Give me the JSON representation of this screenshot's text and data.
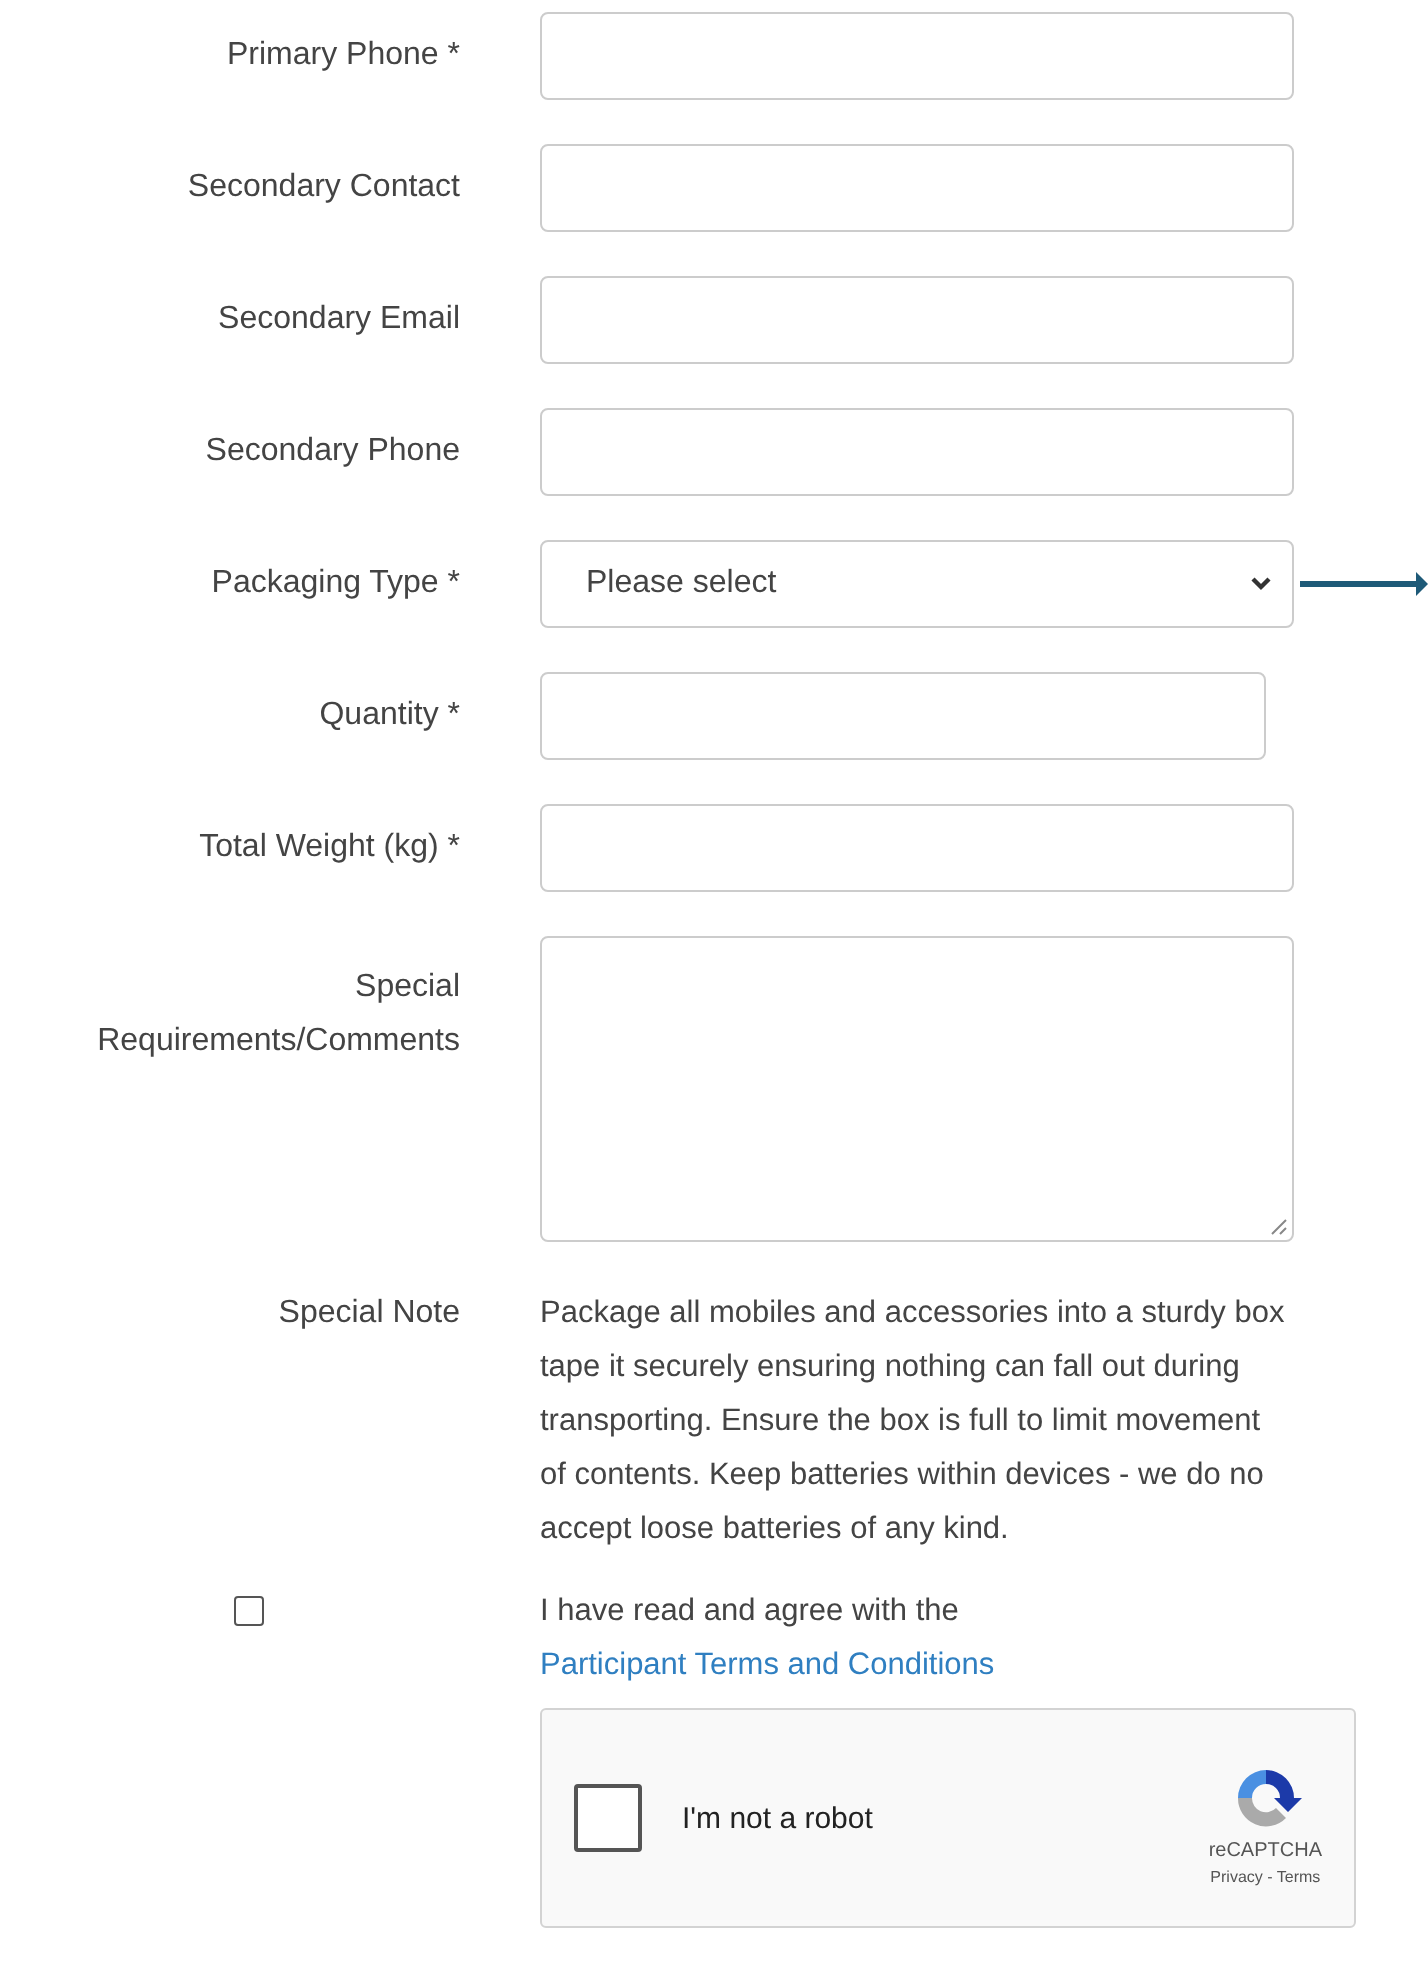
{
  "fields": [
    {
      "label": "Primary Phone *",
      "kind": "text"
    },
    {
      "label": "Secondary Contact",
      "kind": "text"
    },
    {
      "label": "Secondary Email",
      "kind": "text"
    },
    {
      "label": "Secondary Phone",
      "kind": "text"
    },
    {
      "label": "Packaging Type *",
      "kind": "select",
      "value": "Please select"
    },
    {
      "label": "Quantity *",
      "kind": "short"
    },
    {
      "label": "Total Weight (kg) *",
      "kind": "text"
    },
    {
      "label": "Special Requirements/Comments",
      "kind": "textarea"
    }
  ],
  "note": {
    "label": "Special Note",
    "lines": [
      "Package all mobiles and accessories into a sturdy box",
      "tape it securely ensuring nothing can fall out during",
      "transporting. Ensure the box is full to limit movement",
      "of contents. Keep batteries within devices - we do no",
      "accept loose batteries of any kind."
    ]
  },
  "agreement": {
    "checked": false,
    "text": "I have read and agree with the",
    "link": "Participant Terms and Conditions"
  },
  "captcha": {
    "checked": false,
    "label": "I'm not a robot",
    "brand": "reCAPTCHA",
    "links": "Privacy - Terms"
  }
}
